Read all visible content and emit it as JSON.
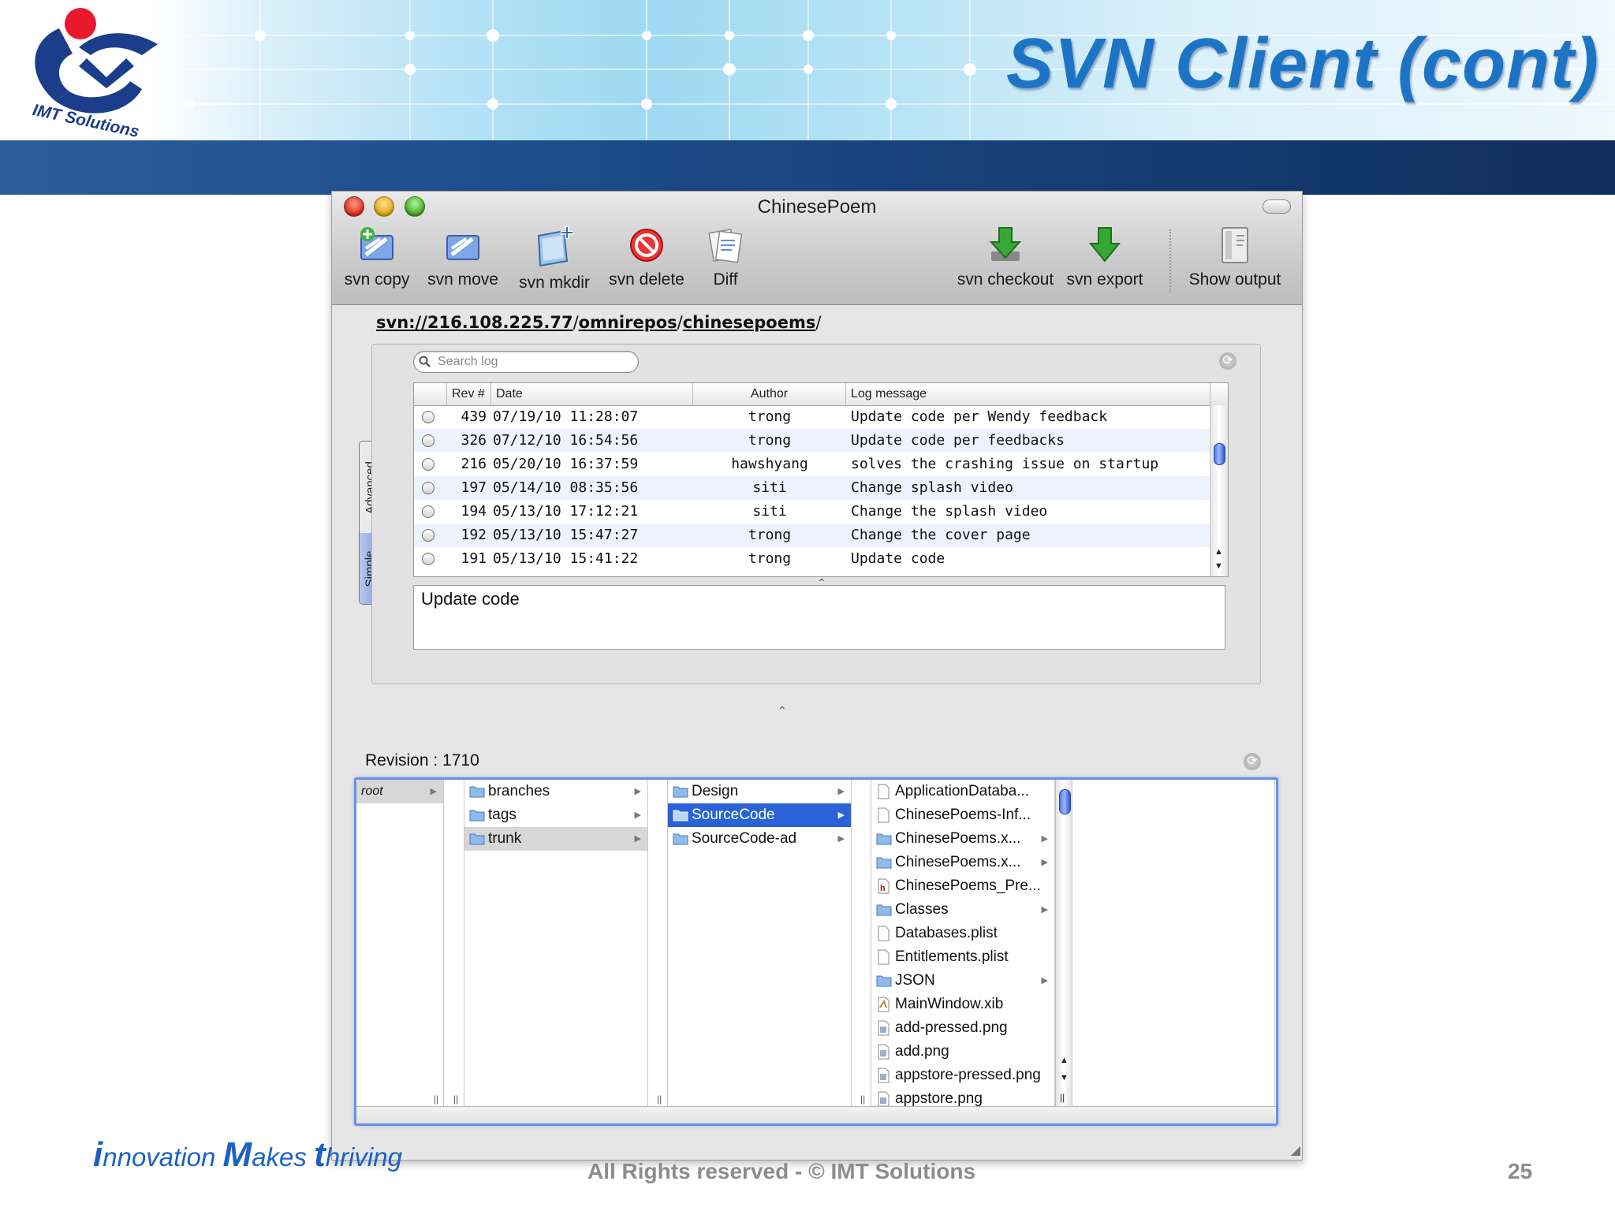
{
  "slide": {
    "title": "SVN Client (cont)",
    "logo_text": "IMT Solutions",
    "slogan_parts": [
      "i",
      "nnovation ",
      "M",
      "akes ",
      "t",
      "hriving"
    ],
    "copyright": "All Rights reserved -  © IMT Solutions",
    "page_number": "25"
  },
  "window": {
    "title": "ChinesePoem",
    "toolbar": [
      {
        "label": "svn copy",
        "icon": "svn-copy-icon"
      },
      {
        "label": "svn move",
        "icon": "svn-move-icon"
      },
      {
        "label": "svn mkdir",
        "icon": "new-folder-icon"
      },
      {
        "label": "svn delete",
        "icon": "delete-icon"
      },
      {
        "label": "Diff",
        "icon": "diff-icon"
      },
      {
        "label": "svn checkout",
        "icon": "checkout-arrow-icon"
      },
      {
        "label": "svn export",
        "icon": "export-arrow-icon"
      },
      {
        "label": "Show output",
        "icon": "output-panel-icon"
      }
    ],
    "path": {
      "prefix": "svn:",
      "sep": "//",
      "host": "216.108.225.77",
      "slash1": "/",
      "repo": "omnirepos",
      "slash2": "/",
      "project": "chinesepoems",
      "slash3": "/"
    },
    "side_tabs": {
      "advanced": "Advanced",
      "simple": "Simple"
    },
    "search": {
      "placeholder": "Search log"
    },
    "log_table": {
      "columns": {
        "rev": "Rev #",
        "date": "Date",
        "author": "Author",
        "message": "Log message"
      },
      "rows": [
        {
          "rev": "439",
          "date": "07/19/10 11:28:07",
          "author": "trong",
          "message": "Update code per Wendy feedback"
        },
        {
          "rev": "326",
          "date": "07/12/10 16:54:56",
          "author": "trong",
          "message": "Update code per feedbacks"
        },
        {
          "rev": "216",
          "date": "05/20/10 16:37:59",
          "author": "hawshyang",
          "message": "solves the crashing issue on startup"
        },
        {
          "rev": "197",
          "date": "05/14/10 08:35:56",
          "author": "siti",
          "message": "Change splash video"
        },
        {
          "rev": "194",
          "date": "05/13/10 17:12:21",
          "author": "siti",
          "message": "Change the splash video"
        },
        {
          "rev": "192",
          "date": "05/13/10 15:47:27",
          "author": "trong",
          "message": "Change the cover page"
        },
        {
          "rev": "191",
          "date": "05/13/10 15:41:22",
          "author": "trong",
          "message": "Update code"
        }
      ]
    },
    "selected_message": "Update code",
    "revision_label": "Revision : 1710",
    "browser": {
      "col1": [
        {
          "label": "root"
        }
      ],
      "col2": [
        {
          "label": "branches"
        },
        {
          "label": "tags"
        },
        {
          "label": "trunk"
        }
      ],
      "col3": [
        {
          "label": "Design"
        },
        {
          "label": "SourceCode"
        },
        {
          "label": "SourceCode-ad"
        }
      ],
      "col4": [
        {
          "label": "ApplicationDataba...",
          "icon": "file-icon"
        },
        {
          "label": "ChinesePoems-Inf...",
          "icon": "file-icon"
        },
        {
          "label": "ChinesePoems.x...",
          "icon": "folder-icon"
        },
        {
          "label": "ChinesePoems.x...",
          "icon": "folder-icon"
        },
        {
          "label": "ChinesePoems_Pre...",
          "icon": "header-file-icon"
        },
        {
          "label": "Classes",
          "icon": "folder-icon"
        },
        {
          "label": "Databases.plist",
          "icon": "file-icon"
        },
        {
          "label": "Entitlements.plist",
          "icon": "file-icon"
        },
        {
          "label": "JSON",
          "icon": "folder-icon"
        },
        {
          "label": "MainWindow.xib",
          "icon": "xib-file-icon"
        },
        {
          "label": "add-pressed.png",
          "icon": "image-file-icon"
        },
        {
          "label": "add.png",
          "icon": "image-file-icon"
        },
        {
          "label": "appstore-pressed.png",
          "icon": "image-file-icon"
        },
        {
          "label": "appstore.png",
          "icon": "image-file-icon"
        }
      ]
    }
  }
}
